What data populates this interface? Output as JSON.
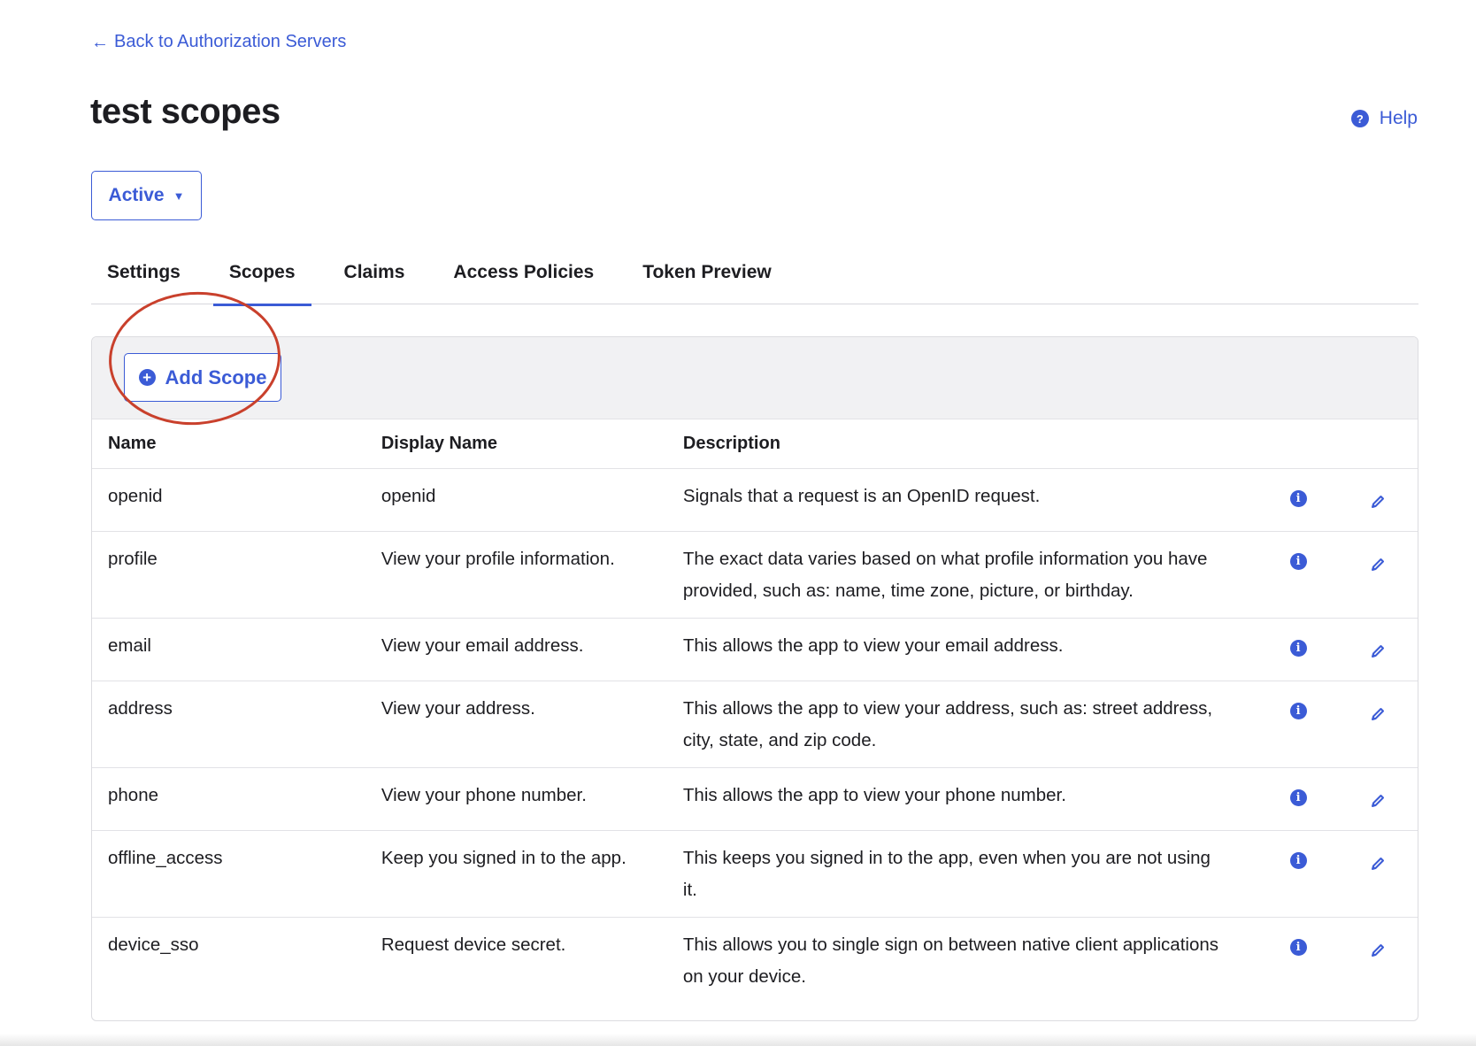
{
  "nav": {
    "back_label": "Back to Authorization Servers",
    "back_icon": "arrow-left-icon"
  },
  "header": {
    "title": "test scopes",
    "help_label": "Help",
    "help_icon": "question-circle-icon"
  },
  "status": {
    "selected": "Active"
  },
  "tabs": [
    {
      "label": "Settings",
      "active": false
    },
    {
      "label": "Scopes",
      "active": true
    },
    {
      "label": "Claims",
      "active": false
    },
    {
      "label": "Access Policies",
      "active": false
    },
    {
      "label": "Token Preview",
      "active": false
    }
  ],
  "toolbar": {
    "add_scope_label": "Add Scope",
    "add_icon": "plus-circle-icon",
    "highlight_color": "#c9402c"
  },
  "table": {
    "columns": [
      "Name",
      "Display Name",
      "Description"
    ],
    "rows": [
      {
        "name": "openid",
        "display_name": "openid",
        "description": "Signals that a request is an OpenID request."
      },
      {
        "name": "profile",
        "display_name": "View your profile information.",
        "description": "The exact data varies based on what profile information you have provided, such as: name, time zone, picture, or birthday."
      },
      {
        "name": "email",
        "display_name": "View your email address.",
        "description": "This allows the app to view your email address."
      },
      {
        "name": "address",
        "display_name": "View your address.",
        "description": "This allows the app to view your address, such as: street address, city, state, and zip code."
      },
      {
        "name": "phone",
        "display_name": "View your phone number.",
        "description": "This allows the app to view your phone number."
      },
      {
        "name": "offline_access",
        "display_name": "Keep you signed in to the app.",
        "description": "This keeps you signed in to the app, even when you are not using it."
      },
      {
        "name": "device_sso",
        "display_name": "Request device secret.",
        "description": "This allows you to single sign on between native client applications on your device."
      }
    ]
  },
  "colors": {
    "accent": "#3b5bd6",
    "text": "#1d1d21",
    "border": "#e2e2e6",
    "toolbar_bg": "#f1f1f3"
  }
}
